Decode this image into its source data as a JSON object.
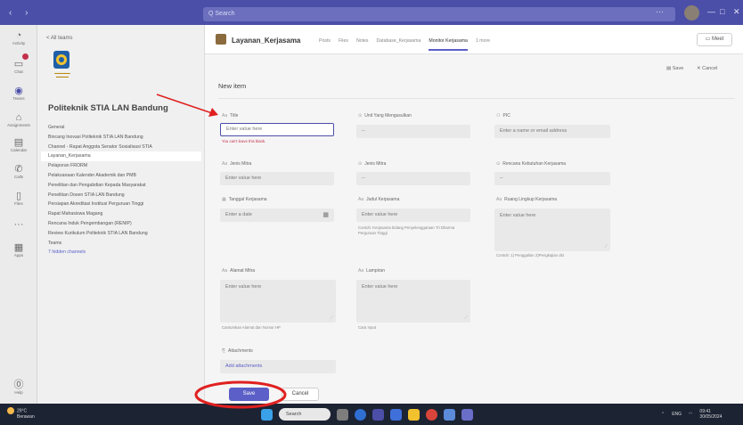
{
  "window": {
    "search_placeholder": "Q Search",
    "controls": [
      "—",
      "□",
      "✕"
    ],
    "more": "···"
  },
  "rail": [
    {
      "label": "Activity",
      "icon": "bell-icon",
      "glyph": "◔"
    },
    {
      "label": "Chat",
      "icon": "chat-icon",
      "glyph": "▭"
    },
    {
      "label": "Teams",
      "icon": "teams-icon",
      "glyph": "◉"
    },
    {
      "label": "Assignments",
      "icon": "assignments-icon",
      "glyph": "⌂"
    },
    {
      "label": "Calendar",
      "icon": "calendar-icon",
      "glyph": "▤"
    },
    {
      "label": "Calls",
      "icon": "phone-icon",
      "glyph": "✆"
    },
    {
      "label": "Files",
      "icon": "file-icon",
      "glyph": "▯"
    },
    {
      "label": "",
      "icon": "more-icon",
      "glyph": "···"
    },
    {
      "label": "Apps",
      "icon": "apps-icon",
      "glyph": "▦"
    },
    {
      "label": "Help",
      "icon": "help-icon",
      "glyph": "⓪"
    }
  ],
  "pane": {
    "back": "< All teams",
    "team_name": "Politeknik STIA LAN Bandung",
    "channels": [
      {
        "label": "General",
        "selected": false
      },
      {
        "label": "Bincang Inovasi Politeknik STIA LAN Bandung",
        "selected": false
      },
      {
        "label": "Channel - Rapat Anggota Senator Sosialisasi STIA",
        "selected": false
      },
      {
        "label": "Layanan_Kerjasama",
        "selected": true
      },
      {
        "label": "Pelaporan FRORM",
        "selected": false
      },
      {
        "label": "Pelaksanaan Kalender Akademik dan PMB",
        "selected": false
      },
      {
        "label": "Penelitian dan Pengabdian Kepada Masyarakat",
        "selected": false
      },
      {
        "label": "Penelitian Dosen STIA LAN Bandung",
        "selected": false
      },
      {
        "label": "Persiapan Akreditasi Institusi Perguruan Tinggi",
        "selected": false
      },
      {
        "label": "Rapat Mahasiswa Magang",
        "selected": false
      },
      {
        "label": "Rencana Induk Pengembangan (RENIP)",
        "selected": false
      },
      {
        "label": "Review Kurikulum Politeknik STIA LAN Bandung",
        "selected": false
      },
      {
        "label": "Teams",
        "selected": false
      }
    ],
    "hidden_channels": "7 hidden channels"
  },
  "tabbar": {
    "channel_title": "Layanan_Kerjasama",
    "tabs": [
      {
        "label": "Posts",
        "active": false
      },
      {
        "label": "Files",
        "active": false
      },
      {
        "label": "Notes",
        "active": false
      },
      {
        "label": "Database_Kerjasama",
        "active": false
      },
      {
        "label": "Monitor Kerjasama",
        "active": true
      },
      {
        "label": "1 more",
        "active": false
      }
    ],
    "meet": "Meet"
  },
  "form": {
    "save_top": "Save",
    "cancel_top": "Cancel",
    "title": "New item",
    "fields": {
      "title": {
        "label": "Title",
        "placeholder": "Enter value here",
        "error": "You can't leave this blank."
      },
      "unit": {
        "label": "Unit Yang Mengusulkan",
        "value": "--"
      },
      "pic": {
        "label": "PIC",
        "placeholder": "Enter a name or email address"
      },
      "jenis_mitra": {
        "label": "Jenis Mitra",
        "placeholder": "Enter value here"
      },
      "jenis_mitra2": {
        "label": "Jenis Mitra",
        "value": "--"
      },
      "rencana": {
        "label": "Rencana Kebutuhan Kerjasama",
        "value": "--"
      },
      "tanggal": {
        "label": "Tanggal Kerjasama",
        "placeholder": "Enter a date"
      },
      "judul": {
        "label": "Judul Kerjasama",
        "placeholder": "Enter value here",
        "hint": "Contoh: Kerjasama bidang Penyelenggaraan Tri Dharma Perguruan Tinggi"
      },
      "ruang": {
        "label": "Ruang Lingkup Kerjasama",
        "placeholder": "Enter value here",
        "hint": "Contoh: 1) Penggalian 2)Pengkajian dst"
      },
      "alamat": {
        "label": "Alamat Mitra",
        "placeholder": "Enter value here",
        "hint": "Cantumkan Alamat dan Nomor HP"
      },
      "lampiran": {
        "label": "Lampiran",
        "placeholder": "Enter value here",
        "hint": "Cara Input"
      },
      "attachments": {
        "label": "Attachments",
        "link": "Add attachments"
      }
    },
    "save": "Save",
    "cancel": "Cancel"
  },
  "taskbar": {
    "weather_temp": "29°C",
    "weather_desc": "Berawan",
    "search": "Search",
    "tray_lang": "ENG",
    "time": "09:41",
    "date": "30/05/2024"
  },
  "colors": {
    "accent": "#5b5fc7",
    "titlebar": "#4b4fa8",
    "annotation": "#e02020"
  }
}
